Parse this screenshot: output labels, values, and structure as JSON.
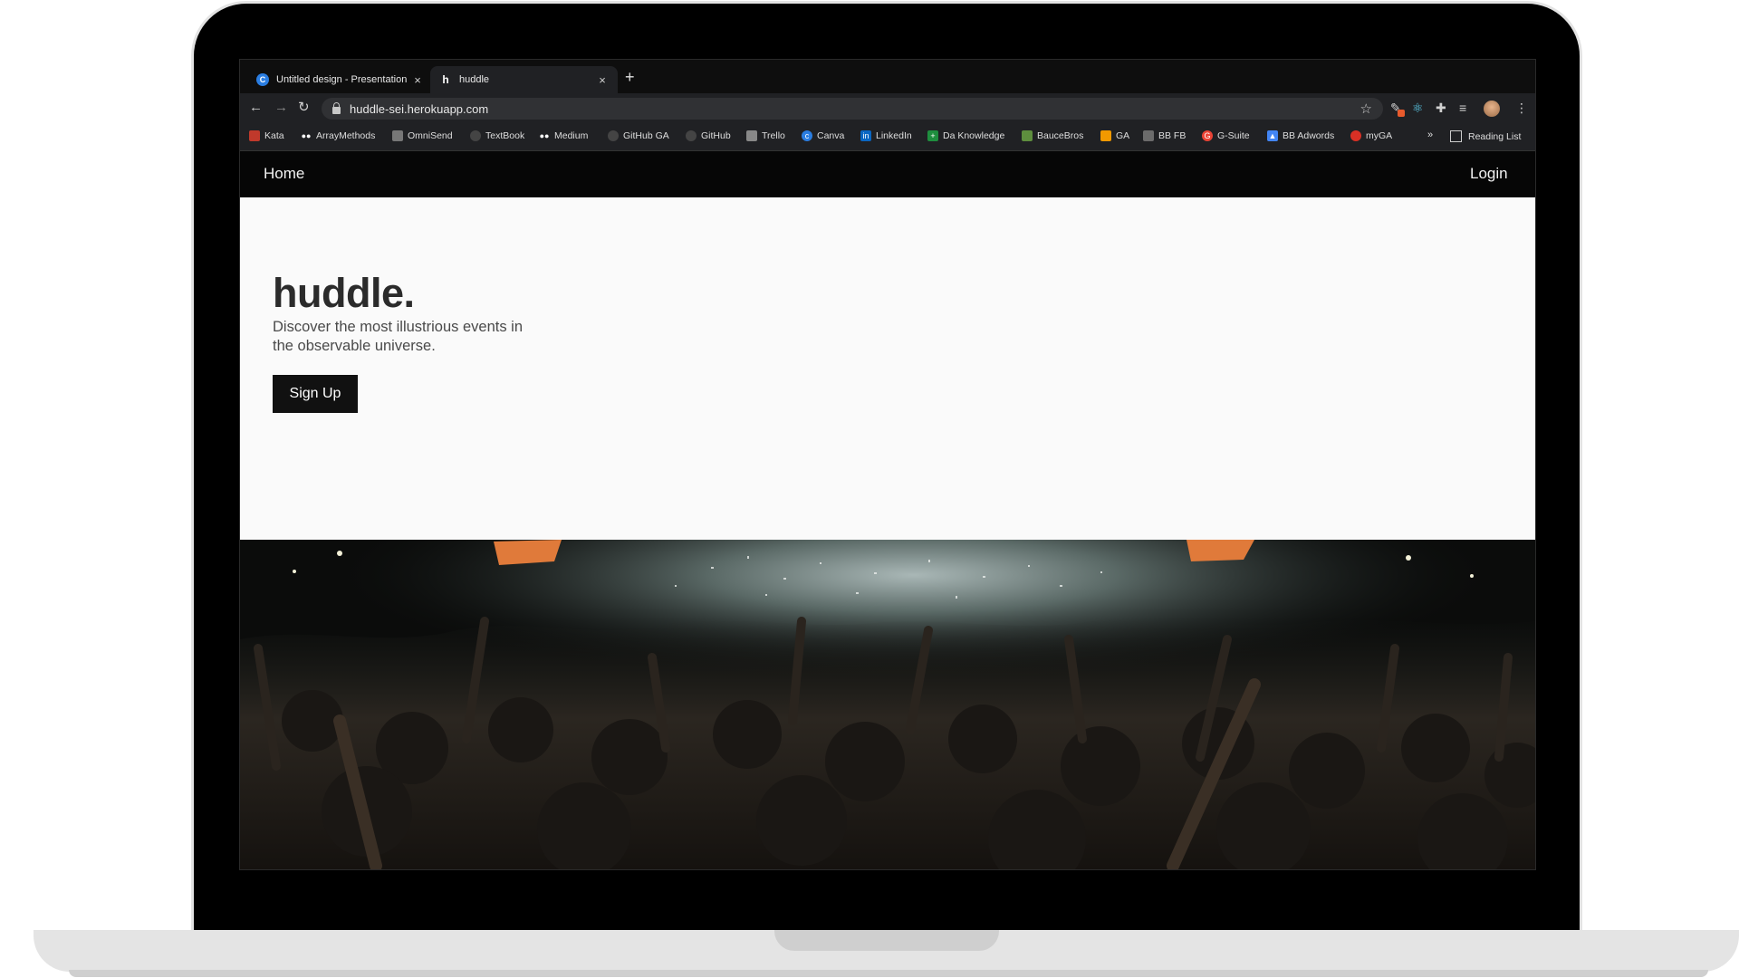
{
  "browser": {
    "tabs": [
      {
        "title": "Untitled design - Presentation",
        "favicon": "canva-icon",
        "active": false
      },
      {
        "title": "huddle",
        "favicon": "huddle-h-icon",
        "active": true
      }
    ],
    "url": "huddle-sei.herokuapp.com",
    "bookmarks": [
      {
        "label": "Kata",
        "icon": "kata-icon",
        "color": "#c0392b"
      },
      {
        "label": "ArrayMethods",
        "icon": "medium-icon",
        "color": "#555555"
      },
      {
        "label": "OmniSend",
        "icon": "omnisend-icon",
        "color": "#777777"
      },
      {
        "label": "TextBook",
        "icon": "github-icon",
        "color": "#444444"
      },
      {
        "label": "Medium",
        "icon": "medium-icon",
        "color": "#555555"
      },
      {
        "label": "GitHub GA",
        "icon": "github-icon",
        "color": "#444444"
      },
      {
        "label": "GitHub",
        "icon": "github-icon",
        "color": "#444444"
      },
      {
        "label": "Trello",
        "icon": "trello-icon",
        "color": "#888888"
      },
      {
        "label": "Canva",
        "icon": "canva-icon",
        "color": "#2a7de1"
      },
      {
        "label": "LinkedIn",
        "icon": "linkedin-icon",
        "color": "#0a66c2"
      },
      {
        "label": "Da Knowledge",
        "icon": "sheets-icon",
        "color": "#1e8e3e"
      },
      {
        "label": "BauceBros",
        "icon": "shopify-icon",
        "color": "#5e8e3e"
      },
      {
        "label": "GA",
        "icon": "analytics-icon",
        "color": "#f29900"
      },
      {
        "label": "BB FB",
        "icon": "fb-icon",
        "color": "#6b6b6b"
      },
      {
        "label": "G-Suite",
        "icon": "google-icon",
        "color": "#ea4335"
      },
      {
        "label": "BB Adwords",
        "icon": "adwords-icon",
        "color": "#4285f4"
      },
      {
        "label": "myGA",
        "icon": "myga-icon",
        "color": "#d93025"
      }
    ],
    "overflow_chevron": "»",
    "reading_list": "Reading List"
  },
  "site": {
    "nav": {
      "home": "Home",
      "login": "Login"
    },
    "brand": "huddle.",
    "tagline": "Discover the most illustrious events in the observable universe.",
    "cta": "Sign Up",
    "hero_image": "concert-crowd-photo"
  }
}
